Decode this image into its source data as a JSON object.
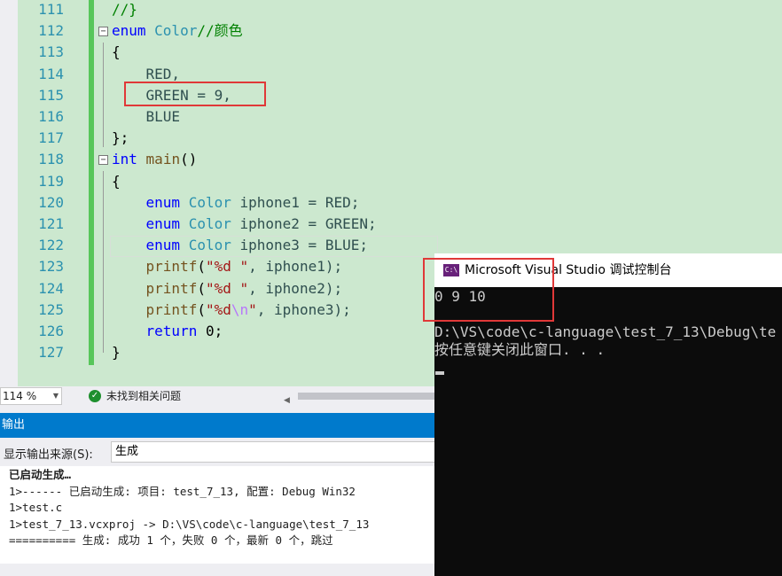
{
  "editor": {
    "lines": [
      {
        "num": "111",
        "segs": [
          {
            "t": "//}",
            "c": "cm"
          }
        ]
      },
      {
        "num": "112",
        "segs": [
          {
            "t": "enum",
            "c": "kw"
          },
          {
            "t": " Color",
            "c": "ty"
          },
          {
            "t": "//颜色",
            "c": "cm"
          }
        ]
      },
      {
        "num": "113",
        "segs": [
          {
            "t": "{",
            "c": ""
          }
        ]
      },
      {
        "num": "114",
        "segs": [
          {
            "t": "    RED,",
            "c": "en"
          }
        ]
      },
      {
        "num": "115",
        "segs": [
          {
            "t": "    GREEN = 9,",
            "c": "en"
          }
        ]
      },
      {
        "num": "116",
        "segs": [
          {
            "t": "    BLUE",
            "c": "en"
          }
        ]
      },
      {
        "num": "117",
        "segs": [
          {
            "t": "};",
            "c": ""
          }
        ]
      },
      {
        "num": "118",
        "segs": [
          {
            "t": "int",
            "c": "kw"
          },
          {
            "t": " ",
            "c": ""
          },
          {
            "t": "main",
            "c": "fn"
          },
          {
            "t": "()",
            "c": ""
          }
        ]
      },
      {
        "num": "119",
        "segs": [
          {
            "t": "{",
            "c": ""
          }
        ]
      },
      {
        "num": "120",
        "segs": [
          {
            "t": "    ",
            "c": ""
          },
          {
            "t": "enum",
            "c": "kw"
          },
          {
            "t": " Color",
            "c": "ty"
          },
          {
            "t": " iphone1 = RED;",
            "c": "en"
          }
        ]
      },
      {
        "num": "121",
        "segs": [
          {
            "t": "    ",
            "c": ""
          },
          {
            "t": "enum",
            "c": "kw"
          },
          {
            "t": " Color",
            "c": "ty"
          },
          {
            "t": " iphone2 = GREEN;",
            "c": "en"
          }
        ]
      },
      {
        "num": "122",
        "segs": [
          {
            "t": "    ",
            "c": ""
          },
          {
            "t": "enum",
            "c": "kw"
          },
          {
            "t": " Color",
            "c": "ty"
          },
          {
            "t": " iphone3 = BLUE;",
            "c": "en"
          }
        ]
      },
      {
        "num": "123",
        "segs": [
          {
            "t": "    ",
            "c": ""
          },
          {
            "t": "printf",
            "c": "fn"
          },
          {
            "t": "(",
            "c": ""
          },
          {
            "t": "\"%d \"",
            "c": "st"
          },
          {
            "t": ", iphone1);",
            "c": "en"
          }
        ]
      },
      {
        "num": "124",
        "segs": [
          {
            "t": "    ",
            "c": ""
          },
          {
            "t": "printf",
            "c": "fn"
          },
          {
            "t": "(",
            "c": ""
          },
          {
            "t": "\"%d \"",
            "c": "st"
          },
          {
            "t": ", iphone2);",
            "c": "en"
          }
        ]
      },
      {
        "num": "125",
        "segs": [
          {
            "t": "    ",
            "c": ""
          },
          {
            "t": "printf",
            "c": "fn"
          },
          {
            "t": "(",
            "c": ""
          },
          {
            "t": "\"%d",
            "c": "st"
          },
          {
            "t": "\\n",
            "c": "es"
          },
          {
            "t": "\"",
            "c": "st"
          },
          {
            "t": ", iphone3);",
            "c": "en"
          }
        ]
      },
      {
        "num": "126",
        "segs": [
          {
            "t": "    ",
            "c": ""
          },
          {
            "t": "return",
            "c": "kw"
          },
          {
            "t": " 0;",
            "c": ""
          }
        ]
      },
      {
        "num": "127",
        "segs": [
          {
            "t": "}",
            "c": ""
          }
        ]
      }
    ]
  },
  "status": {
    "zoom": "114 %",
    "issues": "未找到相关问题"
  },
  "output": {
    "title": "输出",
    "source_label": "显示输出来源(S):",
    "source_value": "生成",
    "lines": [
      "已启动生成…",
      "1>------ 已启动生成: 项目: test_7_13, 配置: Debug Win32",
      "1>test.c",
      "1>test_7_13.vcxproj -> D:\\VS\\code\\c-language\\test_7_13",
      "========== 生成: 成功 1 个，失败 0 个，最新 0 个，跳过"
    ]
  },
  "console": {
    "icon": "C:\\",
    "title": "Microsoft Visual Studio 调试控制台",
    "output": "0 9 10",
    "path_line": "D:\\VS\\code\\c-language\\test_7_13\\Debug\\te",
    "prompt_line": "按任意键关闭此窗口. . ."
  }
}
